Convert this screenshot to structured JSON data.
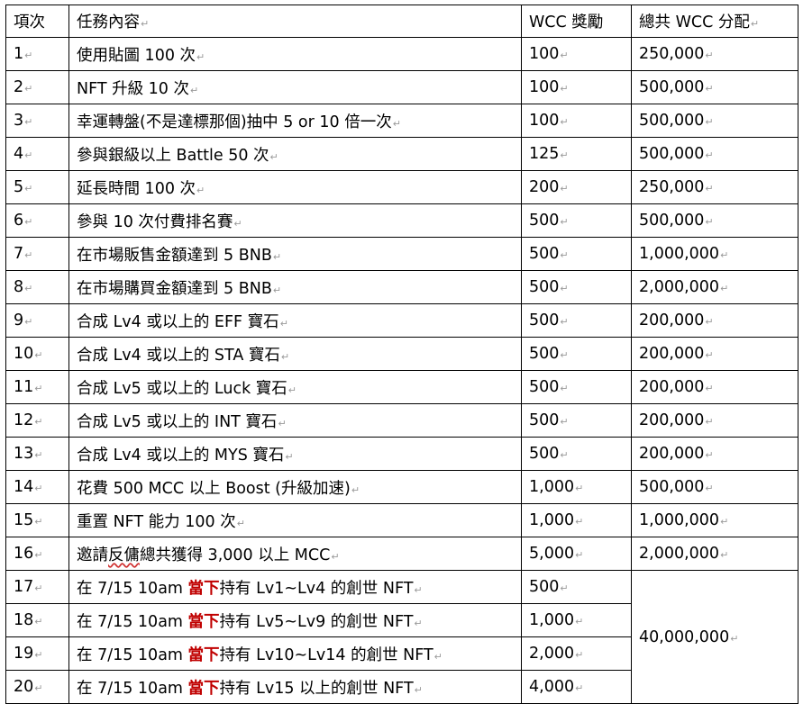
{
  "table": {
    "headers": [
      "項次",
      "任務內容",
      "WCC 獎勵",
      "總共 WCC 分配"
    ],
    "rows": [
      {
        "no": "1",
        "task": "使用貼圖 100 次",
        "reward": "100",
        "total": "250,000"
      },
      {
        "no": "2",
        "task": "NFT 升級 10 次",
        "reward": "100",
        "total": "500,000"
      },
      {
        "no": "3",
        "task": "幸運轉盤(不是達標那個)抽中 5 or 10 倍一次",
        "reward": "100",
        "total": "500,000"
      },
      {
        "no": "4",
        "task": "參與銀級以上 Battle 50  次",
        "reward": "125",
        "total": "500,000"
      },
      {
        "no": "5",
        "task": "延長時間 100 次",
        "reward": "200",
        "total": "250,000"
      },
      {
        "no": "6",
        "task": "參與 10 次付費排名賽",
        "reward": "500",
        "total": "500,000"
      },
      {
        "no": "7",
        "task": "在市場販售金額達到 5 BNB",
        "reward": "500",
        "total": "1,000,000"
      },
      {
        "no": "8",
        "task": "在市場購買金額達到 5 BNB",
        "reward": "500",
        "total": "2,000,000"
      },
      {
        "no": "9",
        "task": "合成 Lv4 或以上的 EFF 寶石",
        "reward": "500",
        "total": "200,000"
      },
      {
        "no": "10",
        "task": "合成 Lv4 或以上的 STA 寶石",
        "reward": "500",
        "total": "200,000"
      },
      {
        "no": "11",
        "task": "合成 Lv5 或以上的 Luck 寶石",
        "reward": "500",
        "total": "200,000"
      },
      {
        "no": "12",
        "task": "合成 Lv5 或以上的 INT 寶石",
        "reward": "500",
        "total": "200,000"
      },
      {
        "no": "13",
        "task": "合成 Lv4 或以上的 MYS 寶石",
        "reward": "500",
        "total": "200,000"
      },
      {
        "no": "14",
        "task": "花費 500 MCC 以上 Boost (升級加速)",
        "reward": "1,000",
        "total": "500,000"
      },
      {
        "no": "15",
        "task": "重置 NFT 能力 100 次",
        "reward": "1,000",
        "total": "1,000,000"
      },
      {
        "no": "16",
        "task_pre": "邀請",
        "task_ul": "反傭",
        "task_post": "總共獲得 3,000 以上 MCC",
        "reward": "5,000",
        "total": "2,000,000"
      }
    ],
    "genesis_rows": [
      {
        "no": "17",
        "pre": "在 7/15 10am ",
        "hl": "當下",
        "post": "持有 Lv1~Lv4 的創世 NFT",
        "reward": "500"
      },
      {
        "no": "18",
        "pre": "在 7/15 10am ",
        "hl": "當下",
        "post": "持有 Lv5~Lv9 的創世 NFT",
        "reward": "1,000"
      },
      {
        "no": "19",
        "pre": "在 7/15 10am ",
        "hl": "當下",
        "post": "持有 Lv10~Lv14 的創世 NFT",
        "reward": "2,000"
      },
      {
        "no": "20",
        "pre": "在 7/15 10am ",
        "hl": "當下",
        "post": "持有 Lv15 以上的創世 NFT",
        "reward": "4,000"
      }
    ],
    "genesis_total": "40,000,000",
    "highlight_color": "#c00000"
  }
}
